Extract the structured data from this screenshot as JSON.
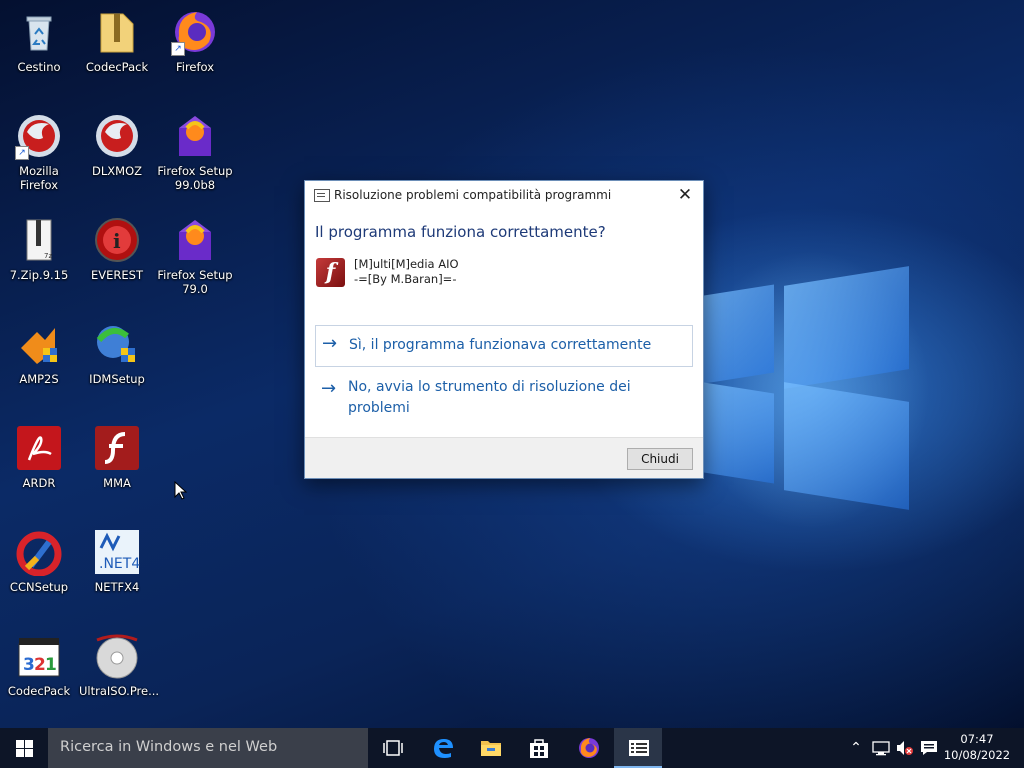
{
  "desktop_icons": [
    {
      "label": "Cestino",
      "icon": "recycle-bin-icon"
    },
    {
      "label": "CodecPack",
      "icon": "zip-folder-icon"
    },
    {
      "label": "Firefox",
      "icon": "firefox-icon"
    },
    {
      "label": "Mozilla Firefox",
      "icon": "firefox-old-icon"
    },
    {
      "label": "DLXMOZ",
      "icon": "firefox-old-icon"
    },
    {
      "label": "Firefox Setup 99.0b8",
      "icon": "firefox-setup-icon"
    },
    {
      "label": "7.Zip.9.15",
      "icon": "7zip-icon"
    },
    {
      "label": "EVEREST",
      "icon": "everest-icon"
    },
    {
      "label": "Firefox Setup 79.0",
      "icon": "firefox-setup-icon"
    },
    {
      "label": "AMP2S",
      "icon": "installer-icon"
    },
    {
      "label": "IDMSetup",
      "icon": "idm-icon"
    },
    {
      "label": "ARDR",
      "icon": "acrobat-reader-icon"
    },
    {
      "label": "MMA",
      "icon": "flash-icon"
    },
    {
      "label": "CCNSetup",
      "icon": "ccleaner-icon"
    },
    {
      "label": "NETFX4",
      "icon": "dotnet-icon"
    },
    {
      "label": "CodecPack",
      "icon": "media-player-classic-icon"
    },
    {
      "label": "UltraISO.Pre...",
      "icon": "ultraiso-icon"
    }
  ],
  "dialog": {
    "title": "Risoluzione problemi compatibilità programmi",
    "heading": "Il programma funziona correttamente?",
    "program_name_line1": "[M]ulti[M]edia AIO",
    "program_name_line2": "-=[By M.Baran]=-",
    "option_yes": "Sì, il programma funzionava correttamente",
    "option_no": "No, avvia lo strumento di risoluzione dei problemi",
    "close_button": "Chiudi",
    "close_glyph": "✕",
    "arrow_glyph": "→",
    "flash_glyph": "f"
  },
  "taskbar": {
    "search_placeholder": "Ricerca in Windows e nel Web",
    "pinned": [
      "task-view-icon",
      "edge-icon",
      "file-explorer-icon",
      "store-icon",
      "firefox-icon",
      "troubleshooter-icon"
    ],
    "tray_chevron": "⌃",
    "clock_time": "07:47",
    "clock_date": "10/08/2022"
  },
  "colors": {
    "accent": "#1c5fa8",
    "heading": "#1e3a78",
    "taskbar": "#0d1527"
  }
}
